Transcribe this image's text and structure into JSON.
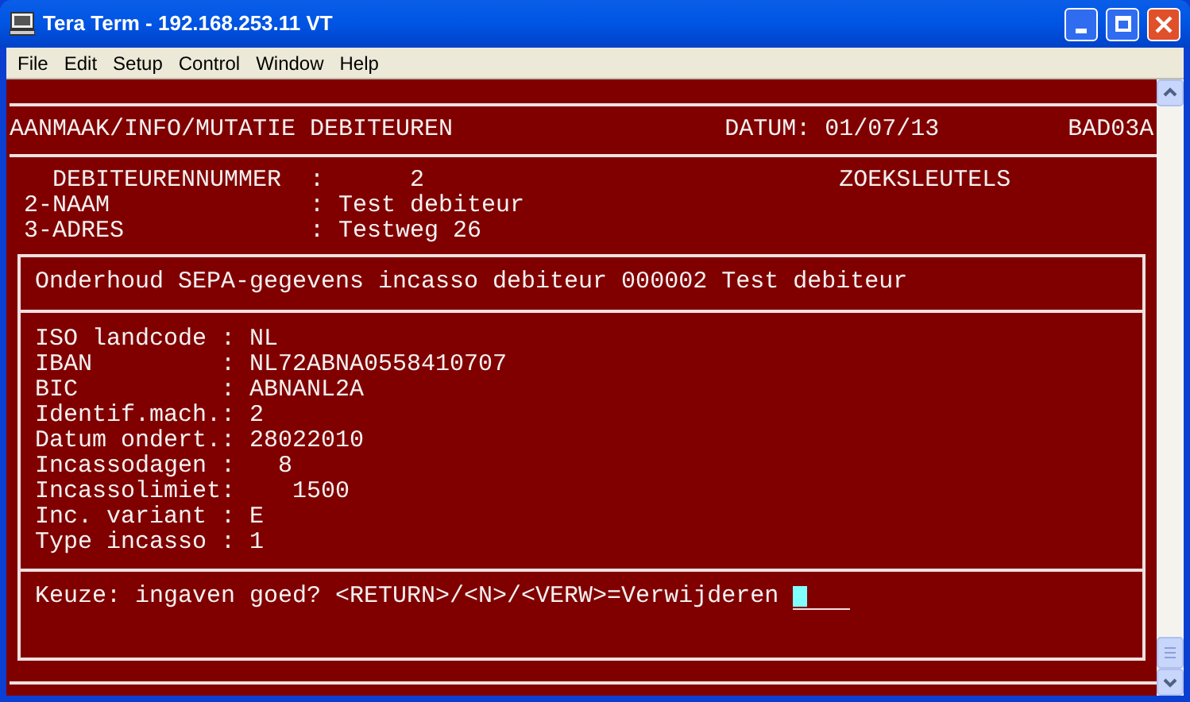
{
  "window": {
    "title": "Tera Term - 192.168.253.11 VT"
  },
  "menu": [
    "File",
    "Edit",
    "Setup",
    "Control",
    "Window",
    "Help"
  ],
  "terminal": {
    "header": {
      "title": "AANMAAK/INFO/MUTATIE DEBITEUREN",
      "date": "DATUM: 01/07/13",
      "code": "BAD03A"
    },
    "record": [
      {
        "label": "DEBITEURENNUMMER",
        "value": ":      2",
        "indent": true
      },
      {
        "label": "2-NAAM",
        "value": ": Test debiteur",
        "indent": false
      },
      {
        "label": "3-ADRES",
        "value": ": Testweg 26",
        "indent": false
      }
    ],
    "search_keys": "ZOEKSLEUTELS",
    "dialog": {
      "title": "Onderhoud SEPA-gegevens incasso debiteur 000002 Test debiteur",
      "fields": [
        {
          "label": "ISO landcode :",
          "value": "NL"
        },
        {
          "label": "IBAN         :",
          "value": "NL72ABNA0558410707"
        },
        {
          "label": "BIC          :",
          "value": "ABNANL2A"
        },
        {
          "label": "Identif.mach.:",
          "value": "2"
        },
        {
          "label": "Datum ondert.:",
          "value": "28022010"
        },
        {
          "label": "Incassodagen :",
          "value": "  8"
        },
        {
          "label": "Incassolimiet:",
          "value": "   1500"
        },
        {
          "label": "Inc. variant :",
          "value": "E"
        },
        {
          "label": "Type incasso :",
          "value": "1"
        }
      ],
      "prompt": "Keuze: ingaven goed? <RETURN>/<N>/<VERW>=Verwijderen"
    }
  }
}
